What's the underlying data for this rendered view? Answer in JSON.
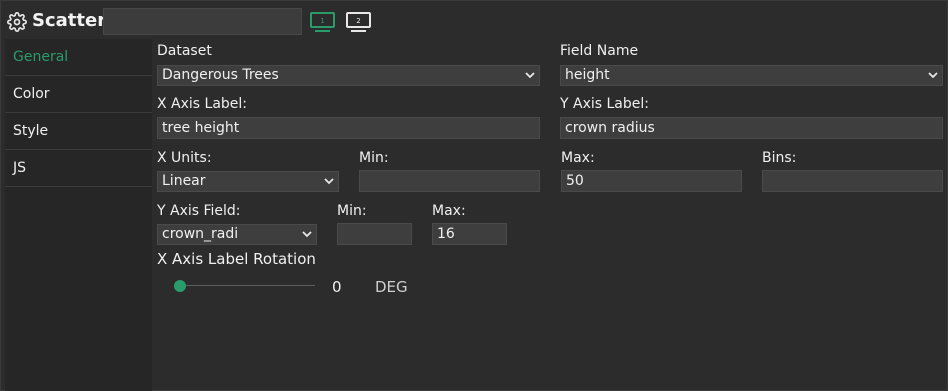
{
  "header": {
    "title": "Scatter",
    "name_value": "",
    "monitor1_label": "1",
    "monitor2_label": "2",
    "accent_color": "#2a9c6c"
  },
  "sidebar": {
    "items": [
      {
        "label": "General",
        "active": true
      },
      {
        "label": "Color",
        "active": false
      },
      {
        "label": "Style",
        "active": false
      },
      {
        "label": "JS",
        "active": false
      }
    ]
  },
  "form": {
    "dataset_label": "Dataset",
    "dataset_value": "Dangerous Trees",
    "field_name_label": "Field Name",
    "field_name_value": "height",
    "x_axis_label_label": "X Axis Label:",
    "x_axis_label_value": "tree height",
    "y_axis_label_label": "Y Axis Label:",
    "y_axis_label_value": "crown radius",
    "x_units_label": "X Units:",
    "x_units_value": "Linear",
    "x_min_label": "Min:",
    "x_min_value": "",
    "x_max_label": "Max:",
    "x_max_value": "50",
    "bins_label": "Bins:",
    "bins_value": "",
    "y_axis_field_label": "Y Axis Field:",
    "y_axis_field_value": "crown_radi",
    "y_min_label": "Min:",
    "y_min_value": "",
    "y_max_label": "Max:",
    "y_max_value": "16",
    "rotation_label": "X Axis Label Rotation",
    "rotation_value": "0",
    "rotation_unit": "DEG"
  }
}
